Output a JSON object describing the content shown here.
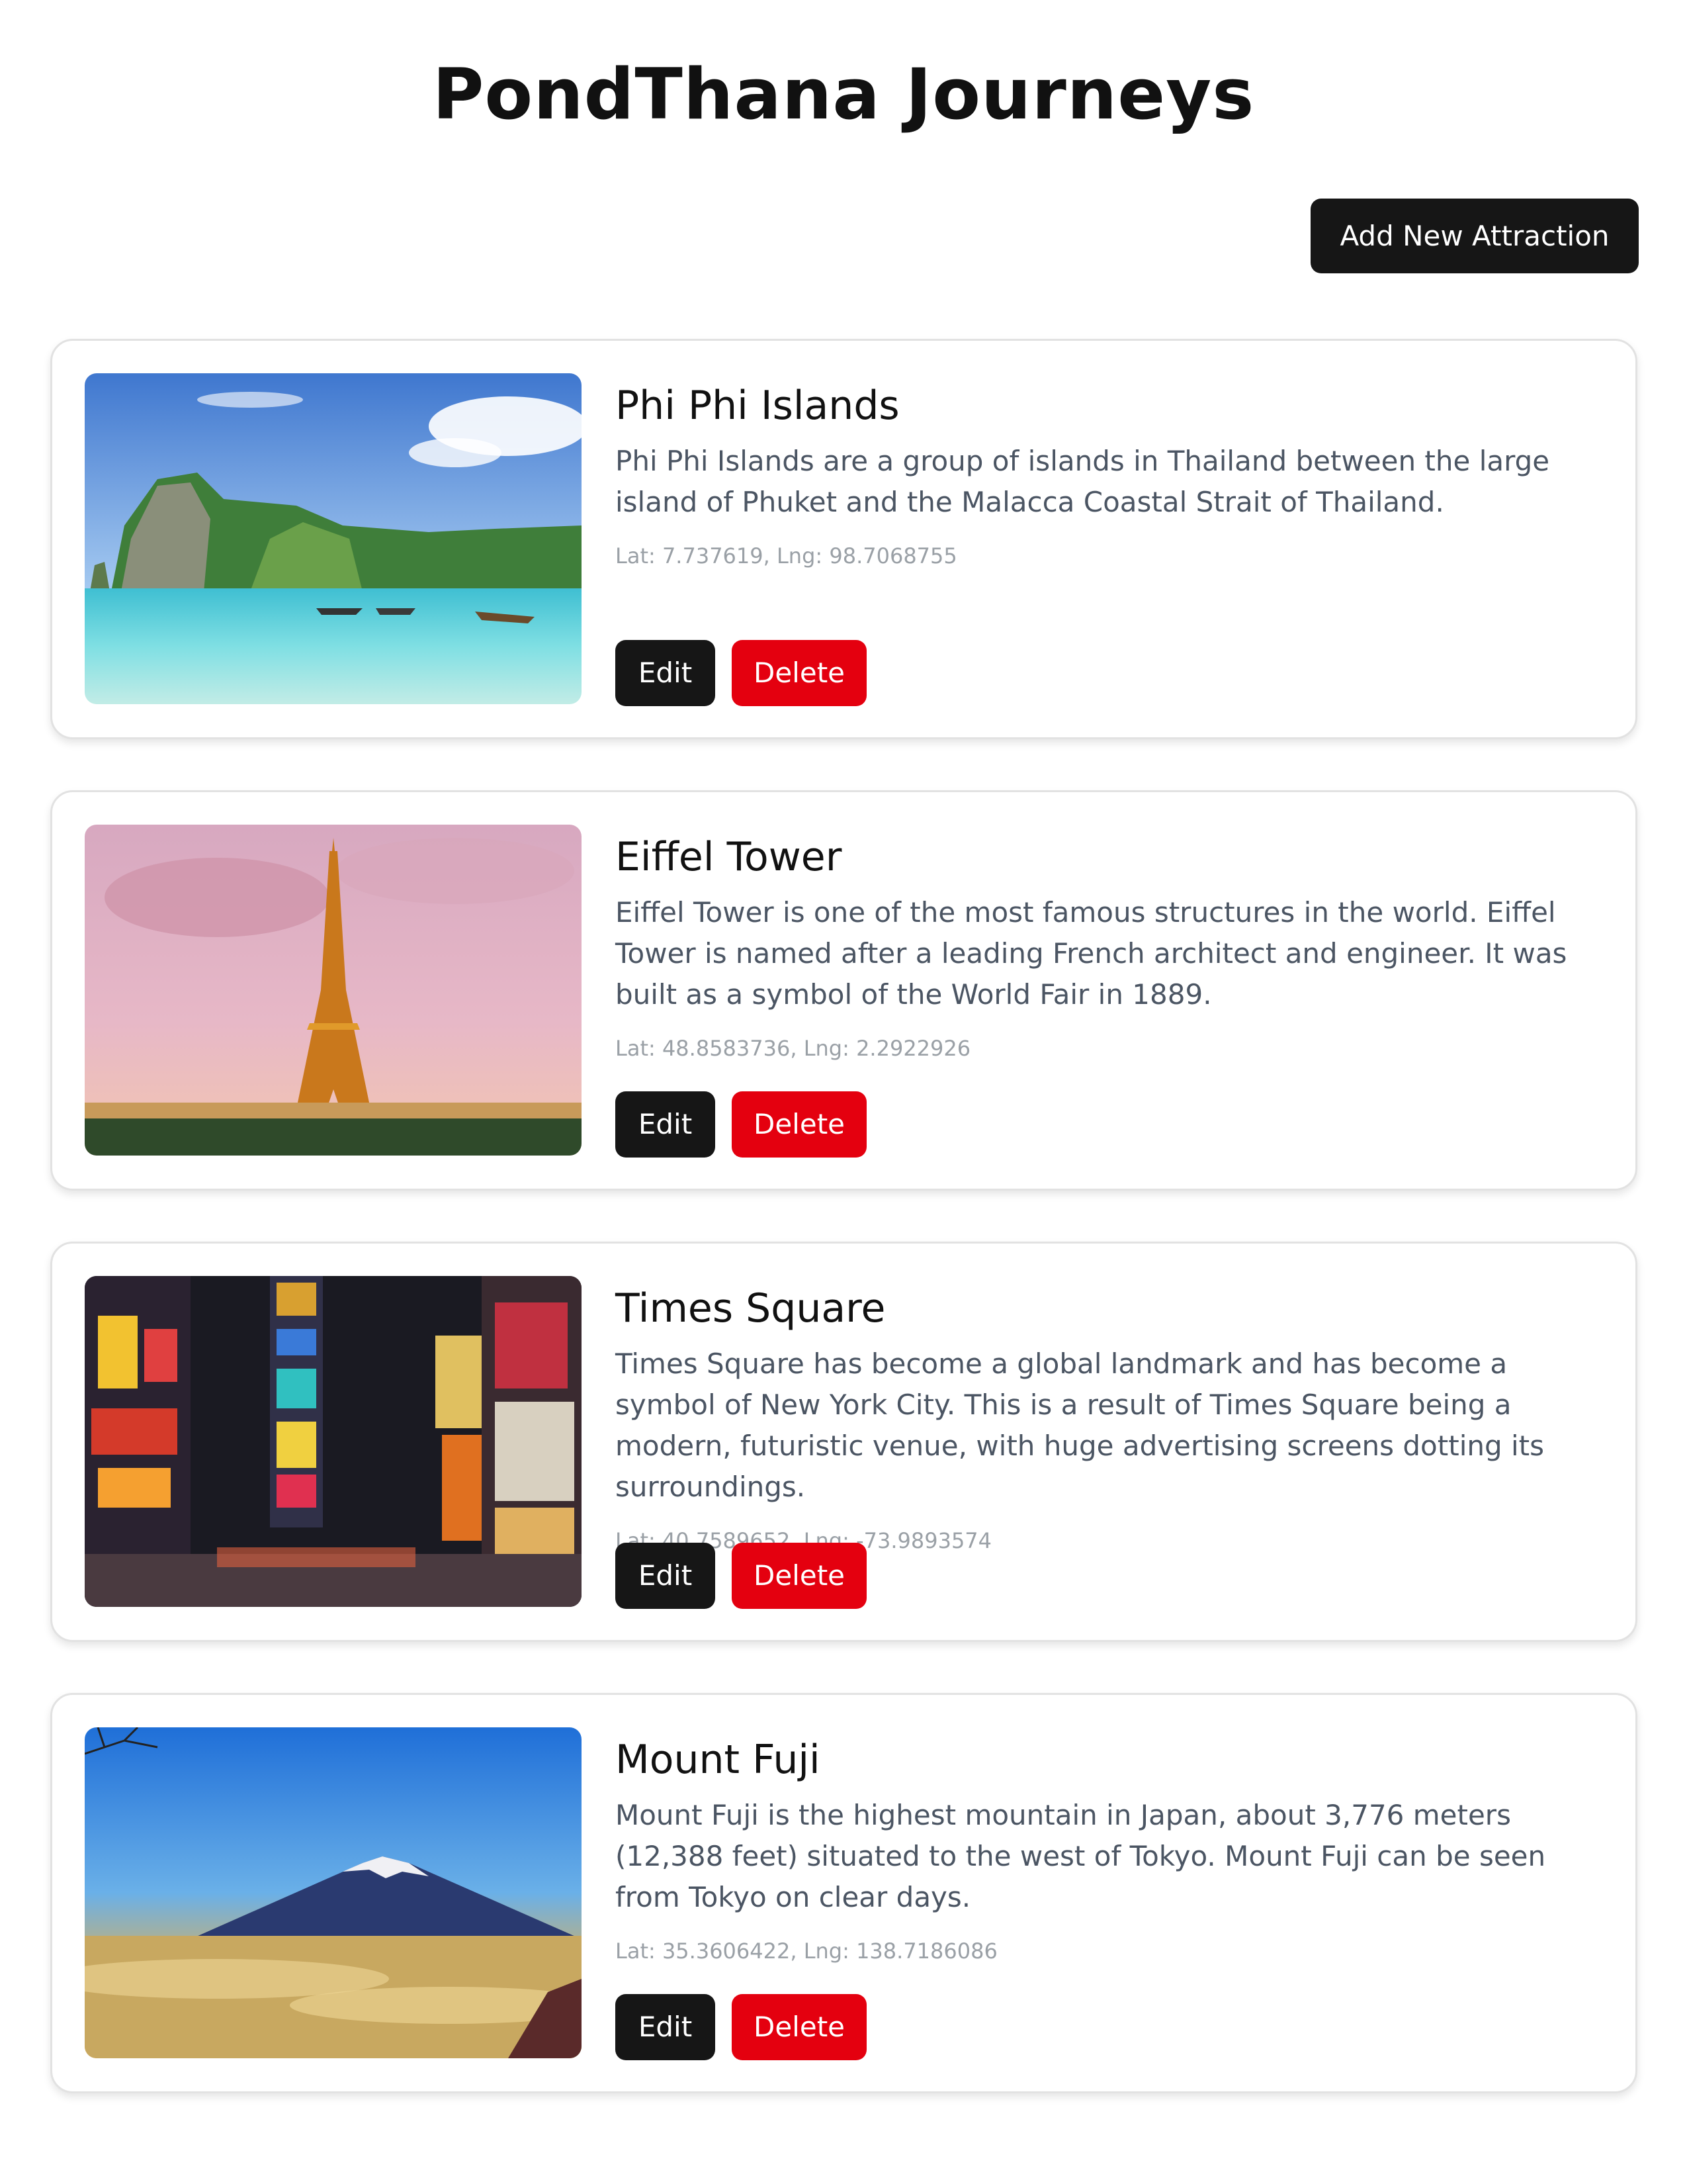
{
  "header": {
    "title": "PondThana Journeys",
    "add_button_label": "Add New Attraction"
  },
  "colors": {
    "primary_button": "#161616",
    "danger_button": "#e4000f",
    "description_text": "#4b5563",
    "coords_text": "#9aa0a6"
  },
  "attractions": [
    {
      "name": "Phi Phi Islands",
      "description": "Phi Phi Islands are a group of islands in Thailand between the large island of Phuket and the Malacca Coastal Strait of Thailand.",
      "coords": "Lat: 7.737619, Lng: 98.7068755",
      "image": "tropical-island-photo",
      "edit_label": "Edit",
      "delete_label": "Delete"
    },
    {
      "name": "Eiffel Tower",
      "description": "Eiffel Tower is one of the most famous structures in the world. Eiffel Tower is named after a leading French architect and engineer. It was built as a symbol of the World Fair in 1889.",
      "coords": "Lat: 48.8583736, Lng: 2.2922926",
      "image": "eiffel-tower-photo",
      "edit_label": "Edit",
      "delete_label": "Delete"
    },
    {
      "name": "Times Square",
      "description": "Times Square has become a global landmark and has become a symbol of New York City. This is a result of Times Square being a modern, futuristic venue, with huge advertising screens dotting its surroundings.",
      "coords": "Lat: 40.7589652, Lng: -73.9893574",
      "image": "times-square-photo",
      "edit_label": "Edit",
      "delete_label": "Delete"
    },
    {
      "name": "Mount Fuji",
      "description": "Mount Fuji is the highest mountain in Japan, about 3,776 meters (12,388 feet) situated to the west of Tokyo. Mount Fuji can be seen from Tokyo on clear days.",
      "coords": "Lat: 35.3606422, Lng: 138.7186086",
      "image": "mount-fuji-photo",
      "edit_label": "Edit",
      "delete_label": "Delete"
    }
  ]
}
